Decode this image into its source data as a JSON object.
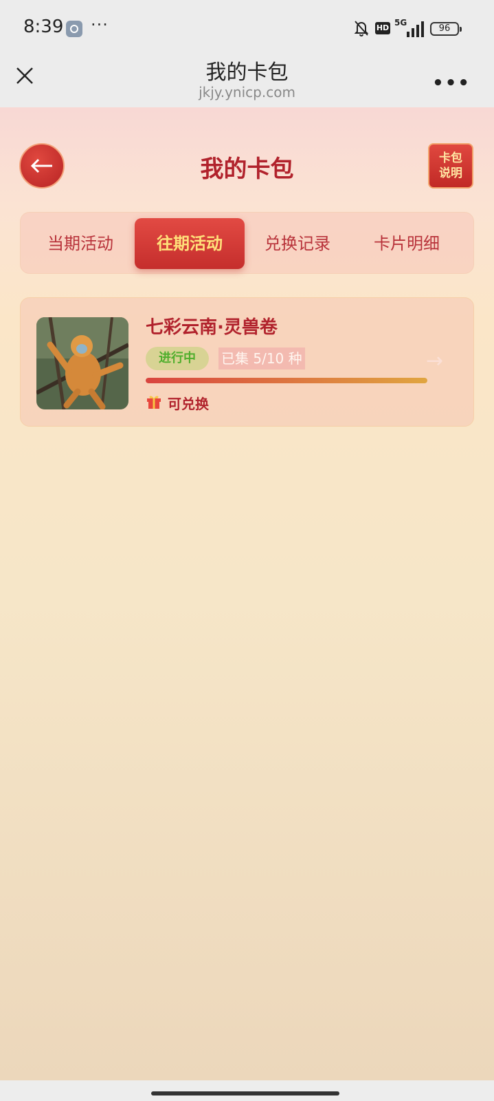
{
  "status_bar": {
    "time": "8:39",
    "more": "···",
    "hd": "HD",
    "network": "5G",
    "battery": "96"
  },
  "title_bar": {
    "title": "我的卡包",
    "domain": "jkjy.ynicp.com"
  },
  "page": {
    "title": "我的卡包",
    "help_button": [
      "卡包",
      "说明"
    ],
    "tabs": [
      {
        "label": "当期活动",
        "active": false
      },
      {
        "label": "往期活动",
        "active": true
      },
      {
        "label": "兑换记录",
        "active": false
      },
      {
        "label": "卡片明细",
        "active": false
      }
    ],
    "card": {
      "title": "七彩云南·灵兽卷",
      "status": "进行中",
      "collected": "已集 5/10 种",
      "progress": 1.0,
      "redeem": "可兑换"
    }
  },
  "colors": {
    "accent": "#b1222c",
    "tab_active_bg": "#d83b37",
    "tab_active_text": "#ffe07a"
  }
}
